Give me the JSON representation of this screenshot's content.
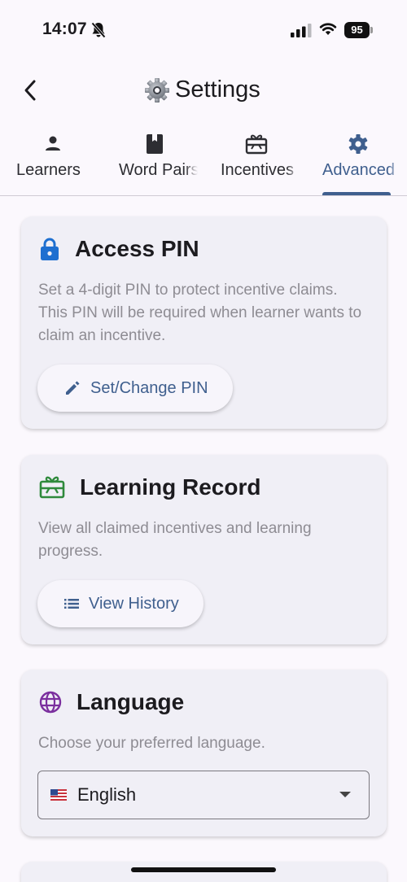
{
  "status_bar": {
    "time": "14:07",
    "battery": "95"
  },
  "header": {
    "title": "Settings",
    "back_icon": "chevron-left-icon",
    "title_icon": "gear-emoji-icon"
  },
  "tabs": [
    {
      "label": "Learners",
      "icon": "person-icon"
    },
    {
      "label": "Word Pairs",
      "icon": "book-icon"
    },
    {
      "label": "Incentives",
      "icon": "gift-card-icon"
    },
    {
      "label": "Advanced",
      "icon": "gear-icon",
      "active": true
    }
  ],
  "cards": {
    "access_pin": {
      "title": "Access PIN",
      "icon": "lock-icon",
      "description": "Set a 4-digit PIN to protect incentive claims. This PIN will be required when learner wants to claim an incentive.",
      "button_label": "Set/Change PIN",
      "button_icon": "pencil-icon"
    },
    "learning_record": {
      "title": "Learning Record",
      "icon": "gift-card-icon",
      "description": "View all claimed incentives and learning progress.",
      "button_label": "View History",
      "button_icon": "list-icon"
    },
    "language": {
      "title": "Language",
      "icon": "globe-icon",
      "description": "Choose your preferred language.",
      "selected": "English",
      "flag": "us-flag-icon"
    }
  },
  "colors": {
    "accent": "#3f5f8e",
    "lock": "#1e6fd0",
    "gift": "#2f8a3c",
    "globe": "#7b2f9e",
    "card_bg": "#f0eff6",
    "page_bg": "#fbf8fd"
  }
}
